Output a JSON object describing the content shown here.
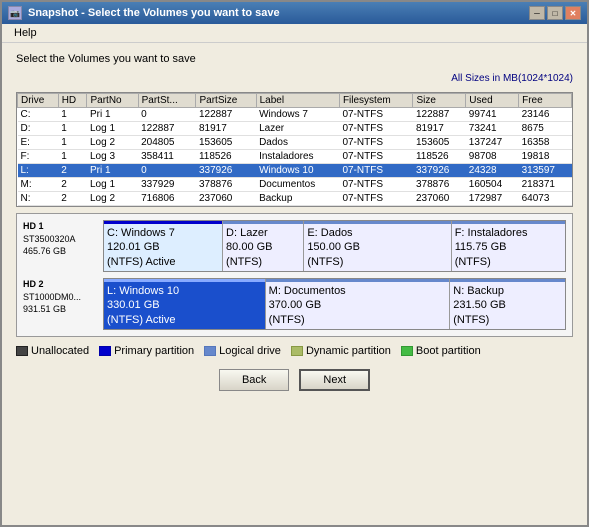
{
  "window": {
    "title": "Snapshot - Select the Volumes you want to save",
    "help_label": "Help"
  },
  "header": {
    "subtitle": "Select the Volumes you want to save",
    "sizes_note": "All Sizes in MB(1024*1024)"
  },
  "table": {
    "columns": [
      "Drive",
      "HD",
      "PartNo",
      "PartSt...",
      "PartSize",
      "Label",
      "Filesystem",
      "Size",
      "Used",
      "Free"
    ],
    "rows": [
      {
        "drive": "C:",
        "hd": "1",
        "partno": "Pri 1",
        "partst": "0",
        "partsize": "122887",
        "label": "Windows 7",
        "fs": "07-NTFS",
        "size": "122887",
        "used": "99741",
        "free": "23146",
        "selected": false
      },
      {
        "drive": "D:",
        "hd": "1",
        "partno": "Log 1",
        "partst": "122887",
        "partsize": "81917",
        "label": "Lazer",
        "fs": "07-NTFS",
        "size": "81917",
        "used": "73241",
        "free": "8675",
        "selected": false
      },
      {
        "drive": "E:",
        "hd": "1",
        "partno": "Log 2",
        "partst": "204805",
        "partsize": "153605",
        "label": "Dados",
        "fs": "07-NTFS",
        "size": "153605",
        "used": "137247",
        "free": "16358",
        "selected": false
      },
      {
        "drive": "F:",
        "hd": "1",
        "partno": "Log 3",
        "partst": "358411",
        "partsize": "118526",
        "label": "Instaladores",
        "fs": "07-NTFS",
        "size": "118526",
        "used": "98708",
        "free": "19818",
        "selected": false
      },
      {
        "drive": "L:",
        "hd": "2",
        "partno": "Pri 1",
        "partst": "0",
        "partsize": "337926",
        "label": "Windows 10",
        "fs": "07-NTFS",
        "size": "337926",
        "used": "24328",
        "free": "313597",
        "selected": true
      },
      {
        "drive": "M:",
        "hd": "2",
        "partno": "Log 1",
        "partst": "337929",
        "partsize": "378876",
        "label": "Documentos",
        "fs": "07-NTFS",
        "size": "378876",
        "used": "160504",
        "free": "218371",
        "selected": false
      },
      {
        "drive": "N:",
        "hd": "2",
        "partno": "Log 2",
        "partst": "716806",
        "partsize": "237060",
        "label": "Backup",
        "fs": "07-NTFS",
        "size": "237060",
        "used": "172987",
        "free": "64073",
        "selected": false
      }
    ]
  },
  "disk_visualization": {
    "hd1": {
      "label": "HD 1",
      "model": "ST3500320A",
      "size": "465.76 GB",
      "partitions": [
        {
          "drive": "C: Windows 7",
          "size": "120.01 GB",
          "note": "(NTFS) Active",
          "type": "primary",
          "flex": 25
        },
        {
          "drive": "D: Lazer",
          "size": "80.00 GB",
          "note": "(NTFS)",
          "type": "logical",
          "flex": 17
        },
        {
          "drive": "E: Dados",
          "size": "150.00 GB",
          "note": "(NTFS)",
          "type": "logical",
          "flex": 31
        },
        {
          "drive": "F: Instaladores",
          "size": "115.75 GB",
          "note": "(NTFS)",
          "type": "logical",
          "flex": 24
        }
      ]
    },
    "hd2": {
      "label": "HD 2",
      "model": "ST1000DM0...",
      "size": "931.51 GB",
      "partitions": [
        {
          "drive": "L: Windows 10",
          "size": "330.01 GB",
          "note": "(NTFS) Active",
          "type": "primary selected",
          "flex": 35
        },
        {
          "drive": "M: Documentos",
          "size": "370.00 GB",
          "note": "(NTFS)",
          "type": "logical",
          "flex": 40
        },
        {
          "drive": "N: Backup",
          "size": "231.50 GB",
          "note": "(NTFS)",
          "type": "logical",
          "flex": 25
        }
      ]
    }
  },
  "legend": [
    {
      "label": "Unallocated",
      "color": "#444444"
    },
    {
      "label": "Primary partition",
      "color": "#0000cc"
    },
    {
      "label": "Logical drive",
      "color": "#6688cc"
    },
    {
      "label": "Dynamic partition",
      "color": "#aabb66"
    },
    {
      "label": "Boot partition",
      "color": "#44bb44"
    }
  ],
  "buttons": {
    "back": "Back",
    "next": "Next"
  }
}
